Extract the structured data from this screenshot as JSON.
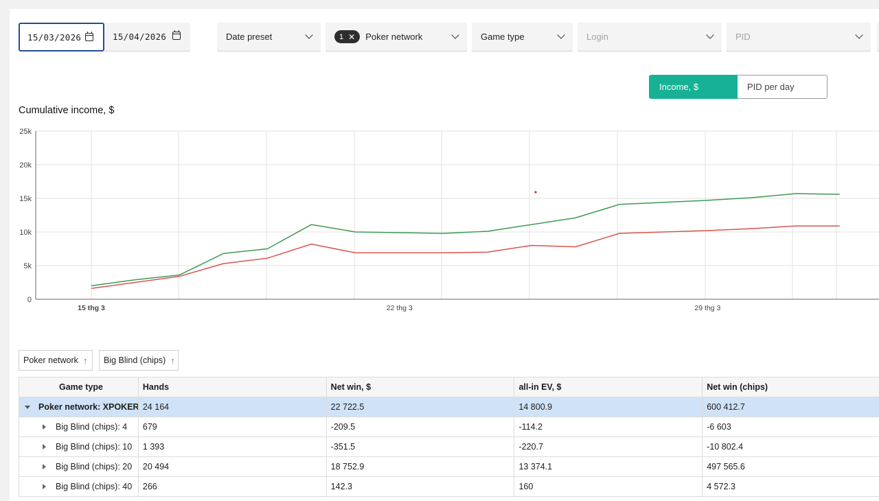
{
  "filters": {
    "date_from": "15/03/2026",
    "date_to": "15/04/2026",
    "date_preset": "Date preset",
    "poker_network": {
      "count": "1",
      "label": "Poker network"
    },
    "game_type": "Game type",
    "login": "Login",
    "pid": "PID"
  },
  "toggles": {
    "income": "Income, $",
    "pid_per_day": "PID per day"
  },
  "chart_title": "Cumulative income, $",
  "chart_data": {
    "type": "line",
    "title": "Cumulative income, $",
    "x_tick_labels": [
      "15 thg 3",
      "22 thg 3",
      "29 thg 3"
    ],
    "x_tick_days": [
      0,
      7,
      14
    ],
    "ylim": [
      0,
      25000
    ],
    "y_ticks": [
      0,
      5000,
      10000,
      15000,
      20000,
      25000
    ],
    "y_tick_labels": [
      "0",
      "5k",
      "10k",
      "15k",
      "20k",
      "25k"
    ],
    "grid": true,
    "x_days": [
      0,
      1,
      2,
      3,
      4,
      5,
      6,
      7,
      8,
      9,
      10,
      11,
      12,
      13,
      14,
      15,
      16,
      17
    ],
    "series": [
      {
        "color": "#3c9a52",
        "values": [
          2000,
          2900,
          3600,
          6800,
          7500,
          11100,
          10000,
          9900,
          9800,
          10100,
          11100,
          12100,
          14100,
          14400,
          14700,
          15100,
          15700,
          15600
        ]
      },
      {
        "color": "#d9534f",
        "values": [
          1600,
          2500,
          3400,
          5300,
          6100,
          8200,
          6900,
          6900,
          6900,
          7000,
          8000,
          7800,
          9800,
          10000,
          10200,
          10500,
          10900,
          10900
        ]
      }
    ]
  },
  "grouping": {
    "chip1": "Poker network",
    "chip2": "Big Blind (chips)",
    "sort_glyph": "↑"
  },
  "table": {
    "headers": [
      "Game type",
      "Hands",
      "Net win, $",
      "all-in EV, $",
      "Net win (chips)"
    ],
    "group_row": [
      "Poker network: XPOKER",
      "24 164",
      "22 722.5",
      "14 800.9",
      "600 412.7"
    ],
    "rows": [
      [
        "Big Blind (chips): 4",
        "679",
        "-209.5",
        "-114.2",
        "-6 603"
      ],
      [
        "Big Blind (chips): 10",
        "1 393",
        "-351.5",
        "-220.7",
        "-10 802.4"
      ],
      [
        "Big Blind (chips): 20",
        "20 494",
        "18 752.9",
        "13 374.1",
        "497 565.6"
      ],
      [
        "Big Blind (chips): 40",
        "266",
        "142.3",
        "160",
        "4 572.3"
      ]
    ]
  }
}
